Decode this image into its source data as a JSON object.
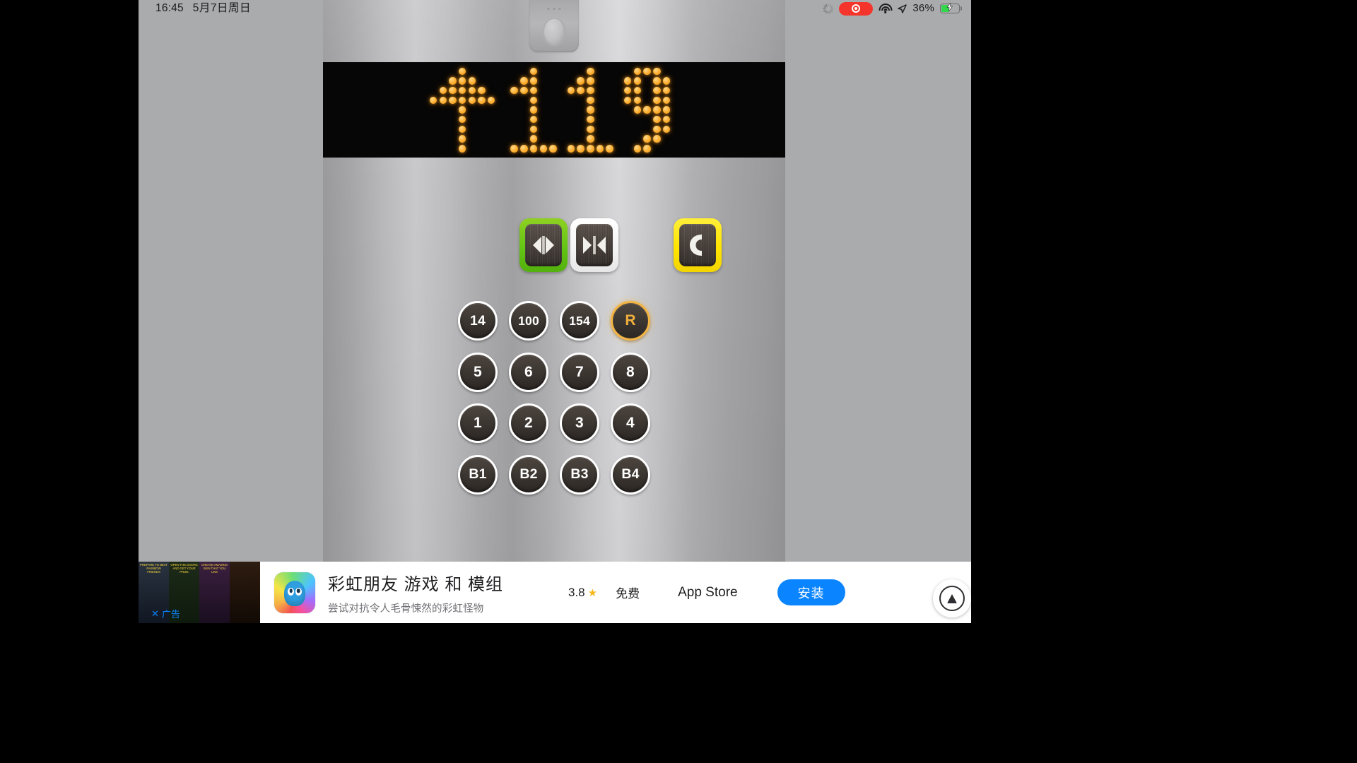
{
  "statusbar": {
    "time": "16:45",
    "date": "5月7日周日",
    "spinner_icon": "activity-spinner-icon",
    "recording_icon": "screen-recording-indicator",
    "wifi_icon": "wifi-icon",
    "location_icon": "location-services-icon",
    "battery_percent": "36%",
    "battery_icon": "battery-charging-icon",
    "battery_color": "#32d74b",
    "recording_color": "#f5352b"
  },
  "display": {
    "direction_icon": "up-arrow-dot-matrix",
    "floor": "119",
    "led_color": "#ffb53a",
    "background": "#060606"
  },
  "function_buttons": [
    {
      "name": "door-open-button",
      "icon": "door-open-icon",
      "label": "Door Open",
      "border_color": "#63c414"
    },
    {
      "name": "door-close-button",
      "icon": "door-close-icon",
      "label": "Door Close",
      "border_color": "#ffffff"
    },
    {
      "name": "call-button",
      "icon": "phone-icon",
      "label": "Call",
      "border_color": "#ffe400"
    }
  ],
  "floor_grid": {
    "rows": [
      [
        {
          "label": "14",
          "active": false
        },
        {
          "label": "100",
          "active": false
        },
        {
          "label": "154",
          "active": false
        },
        {
          "label": "R",
          "active": true
        }
      ],
      [
        {
          "label": "5",
          "active": false
        },
        {
          "label": "6",
          "active": false
        },
        {
          "label": "7",
          "active": false
        },
        {
          "label": "8",
          "active": false
        }
      ],
      [
        {
          "label": "1",
          "active": false
        },
        {
          "label": "2",
          "active": false
        },
        {
          "label": "3",
          "active": false
        },
        {
          "label": "4",
          "active": false
        }
      ],
      [
        {
          "label": "B1",
          "active": false
        },
        {
          "label": "B2",
          "active": false
        },
        {
          "label": "B3",
          "active": false
        },
        {
          "label": "B4",
          "active": false
        }
      ]
    ],
    "active_color": "#f4b441"
  },
  "ad": {
    "title": "彩虹朋友 游戏 和 模组",
    "subtitle": "尝试对抗令人毛骨悚然的彩虹怪物",
    "rating": "3.8",
    "star_icon": "star-icon",
    "price": "免费",
    "store": "App Store",
    "install_label": "安装",
    "close_label": "广告",
    "close_icon": "close-x-icon",
    "install_color": "#0a84ff",
    "thumb_captions": [
      "PREPARE TO BEAT RAINBOW FRIENDS",
      "OPEN THE DOORS AND GET YOUR PRIZE",
      "CREATE AMAZING SKIN THAT YOU LIKE",
      ""
    ]
  },
  "assistive_touch": {
    "icon": "assistive-touch-icon"
  }
}
